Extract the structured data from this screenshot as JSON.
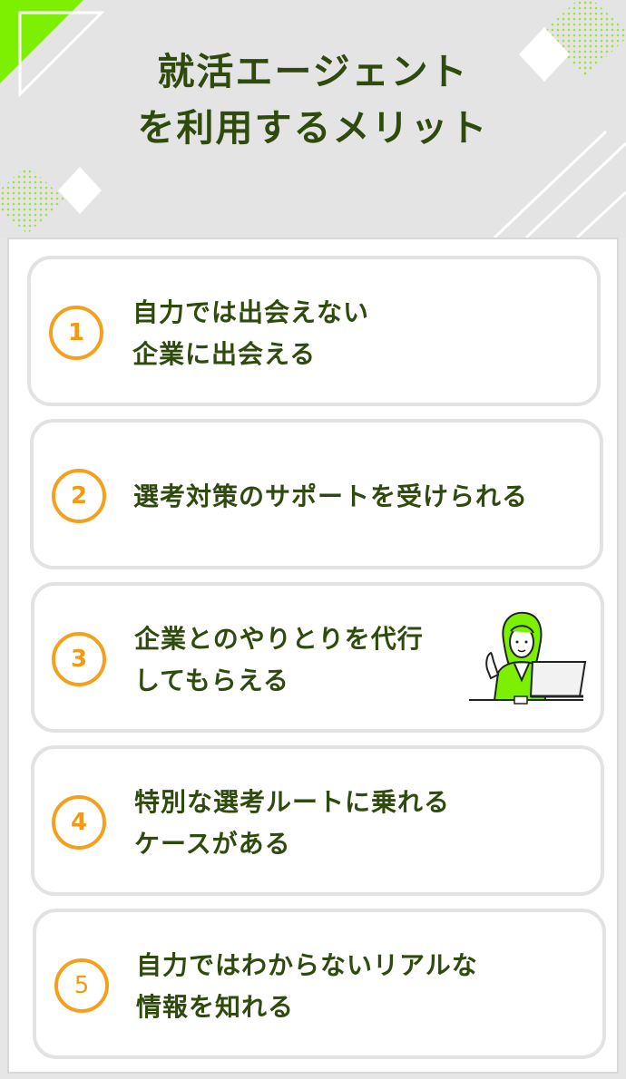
{
  "header": {
    "title_line1": "就活エージェント",
    "title_line2": "を利用するメリット"
  },
  "colors": {
    "accent_green": "#7cf000",
    "title_green": "#2e4a0c",
    "number_orange": "#f5a01c"
  },
  "merits": [
    {
      "number": "1",
      "line1": "自力では出会えない",
      "line2": "企業に出会える"
    },
    {
      "number": "2",
      "line1": "選考対策のサポートを受けられる",
      "line2": ""
    },
    {
      "number": "3",
      "line1": "企業とのやりとりを代行",
      "line2": "してもらえる"
    },
    {
      "number": "4",
      "line1": "特別な選考ルートに乗れる",
      "line2": "ケースがある"
    },
    {
      "number": "5",
      "line1": "自力ではわからないリアルな",
      "line2": "情報を知れる"
    }
  ],
  "illustration": "woman-at-laptop-icon"
}
